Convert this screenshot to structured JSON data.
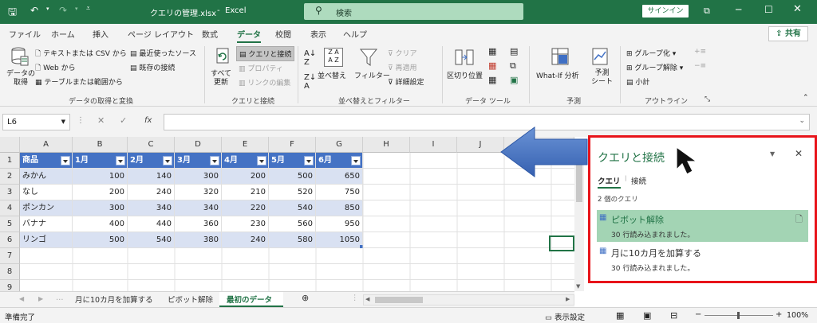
{
  "title_bar": {
    "filename": "クエリの管理.xlsx",
    "app": "Excel",
    "search_label": "検索",
    "signin": "サインイン"
  },
  "tabs": [
    "ファイル",
    "ホーム",
    "挿入",
    "ページ レイアウト",
    "数式",
    "データ",
    "校閲",
    "表示",
    "ヘルプ"
  ],
  "active_tab": "データ",
  "share": "共有",
  "ribbon": {
    "get_data": "データの\n取得",
    "text_csv": "テキストまたは CSV から",
    "web": "Web から",
    "table_range": "テーブルまたは範囲から",
    "recent_sources": "最近使ったソース",
    "existing_conn": "既存の接続",
    "group1": "データの取得と変換",
    "refresh_all": "すべて\n更新",
    "queries_conn": "クエリと接続",
    "properties": "プロパティ",
    "edit_links": "リンクの編集",
    "group2": "クエリと接続",
    "sort": "並べ替え",
    "filter": "フィルター",
    "clear": "クリア",
    "reapply": "再適用",
    "advanced": "詳細設定",
    "group3": "並べ替えとフィルター",
    "text_to_columns": "区切り位置",
    "group4": "データ ツール",
    "what_if": "What-If 分析",
    "forecast_sheet": "予測\nシート",
    "group5": "予測",
    "group_btn": "グループ化",
    "ungroup_btn": "グループ解除",
    "subtotal": "小計",
    "group6": "アウトライン"
  },
  "formula_bar": {
    "name_box": "L6",
    "fx": "fx",
    "formula": ""
  },
  "columns": [
    "A",
    "B",
    "C",
    "D",
    "E",
    "F",
    "G",
    "H",
    "I",
    "J"
  ],
  "rows": [
    "1",
    "2",
    "3",
    "4",
    "5",
    "6",
    "7",
    "8",
    "9"
  ],
  "table": {
    "headers": [
      "商品",
      "1月",
      "2月",
      "3月",
      "4月",
      "5月",
      "6月"
    ],
    "data": [
      [
        "みかん",
        "100",
        "140",
        "300",
        "200",
        "500",
        "650"
      ],
      [
        "なし",
        "200",
        "240",
        "320",
        "210",
        "520",
        "750"
      ],
      [
        "ポンカン",
        "300",
        "340",
        "340",
        "220",
        "540",
        "850"
      ],
      [
        "バナナ",
        "400",
        "440",
        "360",
        "230",
        "560",
        "950"
      ],
      [
        "リンゴ",
        "500",
        "540",
        "380",
        "240",
        "580",
        "1050"
      ]
    ]
  },
  "sheet_tabs": [
    "月に10カ月を加算する",
    "ピボット解除",
    "最初のデータ"
  ],
  "active_sheet": "最初のデータ",
  "status": {
    "ready": "準備完了",
    "display_settings": "表示設定",
    "zoom": "100%"
  },
  "pane": {
    "title": "クエリと接続",
    "tab_queries": "クエリ",
    "tab_connections": "接続",
    "count": "2 個のクエリ",
    "queries": [
      {
        "name": "ピボット解除",
        "info": "30 行読み込まれました。"
      },
      {
        "name": "月に10カ月を加算する",
        "info": "30 行読み込まれました。"
      }
    ]
  },
  "colors": {
    "excel_green": "#217346",
    "table_header": "#4472c4",
    "band": "#d9e1f2",
    "highlight": "#a3d4b4",
    "annotation_red": "#e8141a",
    "arrow_blue": "#3f6fc4"
  }
}
